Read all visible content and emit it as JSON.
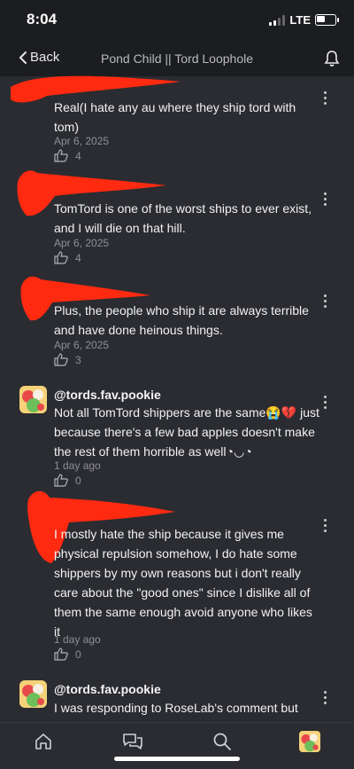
{
  "status": {
    "time": "8:04",
    "network": "LTE"
  },
  "nav": {
    "back_label": "Back",
    "title": "Pond Child || Tord Loophole"
  },
  "comments": [
    {
      "username": "",
      "text": "Real(I hate any au where they ship tord with tom)",
      "date": "Apr 6, 2025",
      "likes": "4"
    },
    {
      "username": "",
      "text": "TomTord is one of the worst ships to ever exist, and I will die on that hill.",
      "date": "Apr 6, 2025",
      "likes": "4"
    },
    {
      "username": "",
      "text": "Plus, the people who ship it are always terrible and have done heinous things.",
      "date": "Apr 6, 2025",
      "likes": "3"
    },
    {
      "username": "@tords.fav.pookie",
      "text": "Not all TomTord shippers are the same😭💔 just because there's a few bad apples doesn't make the rest of them horrible as well◔◡◔",
      "date": "1 day ago",
      "likes": "0"
    },
    {
      "username": "",
      "text": "I mostly hate the ship because it gives me physical repulsion somehow, I do hate some shippers by my own reasons but i don't really care about the \"good ones\" since I dislike all of them the same enough avoid anyone who likes it",
      "date": "1 day ago",
      "likes": "0"
    },
    {
      "username": "@tords.fav.pookie",
      "text": "I was responding to RoseLab's comment but ok..? I don't really get what u mean",
      "date": "",
      "likes": ""
    }
  ],
  "colors": {
    "background": "#2b2c31",
    "bar": "#1c1d20",
    "redaction": "#ff2a10"
  },
  "icons": {
    "like": "thumbs-up-icon",
    "more": "more-vertical-icon",
    "bell": "bell-icon"
  }
}
